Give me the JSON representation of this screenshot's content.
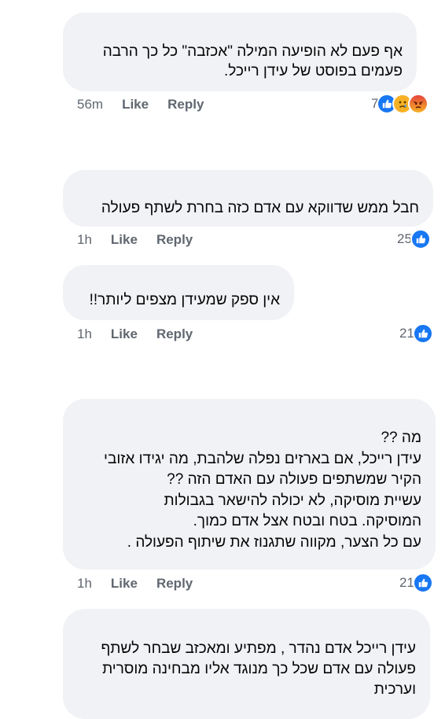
{
  "comments": [
    {
      "text": "אף פעם לא הופיעה המילה \"אכזבה\" כל כך הרבה\nפעמים בפוסט של עידן רייכל.",
      "time": "56m",
      "like_label": "Like",
      "reply_label": "Reply",
      "reaction_count": "7",
      "reactions": [
        "like-icon",
        "sad-icon",
        "angry-icon"
      ]
    },
    {
      "text": "חבל ממש שדווקא עם אדם כזה בחרת לשתף פעולה",
      "time": "1h",
      "like_label": "Like",
      "reply_label": "Reply",
      "reaction_count": "25",
      "reactions": [
        "like-icon"
      ]
    },
    {
      "text": "אין ספק שמעידן מצפים ליותר!!",
      "time": "1h",
      "like_label": "Like",
      "reply_label": "Reply",
      "reaction_count": "21",
      "reactions": [
        "like-icon"
      ]
    },
    {
      "text": "מה ??\nעידן רייכל, אם בארזים נפלה שלהבת, מה יגידו אזובי\nהקיר שמשתפים פעולה עם  האדם הזה ??\nעשיית מוסיקה,  לא יכולה להישאר בגבולות\nהמוסיקה. בטח ובטח אצל אדם כמוך.\nעם כל הצער, מקווה שתגנוז את שיתוף הפעולה .",
      "time": "1h",
      "like_label": "Like",
      "reply_label": "Reply",
      "reaction_count": "21",
      "reactions": [
        "like-icon"
      ]
    },
    {
      "text": "עידן רייכל אדם נהדר , מפתיע ומאכזב שבחר לשתף\nפעולה עם אדם שכל כך מנוגד אליו מבחינה מוסרית\nוערכית"
    }
  ],
  "colors": {
    "bubble_bg": "#f0f2f5",
    "like_blue": "#1877f2",
    "meta_gray": "#606770"
  }
}
